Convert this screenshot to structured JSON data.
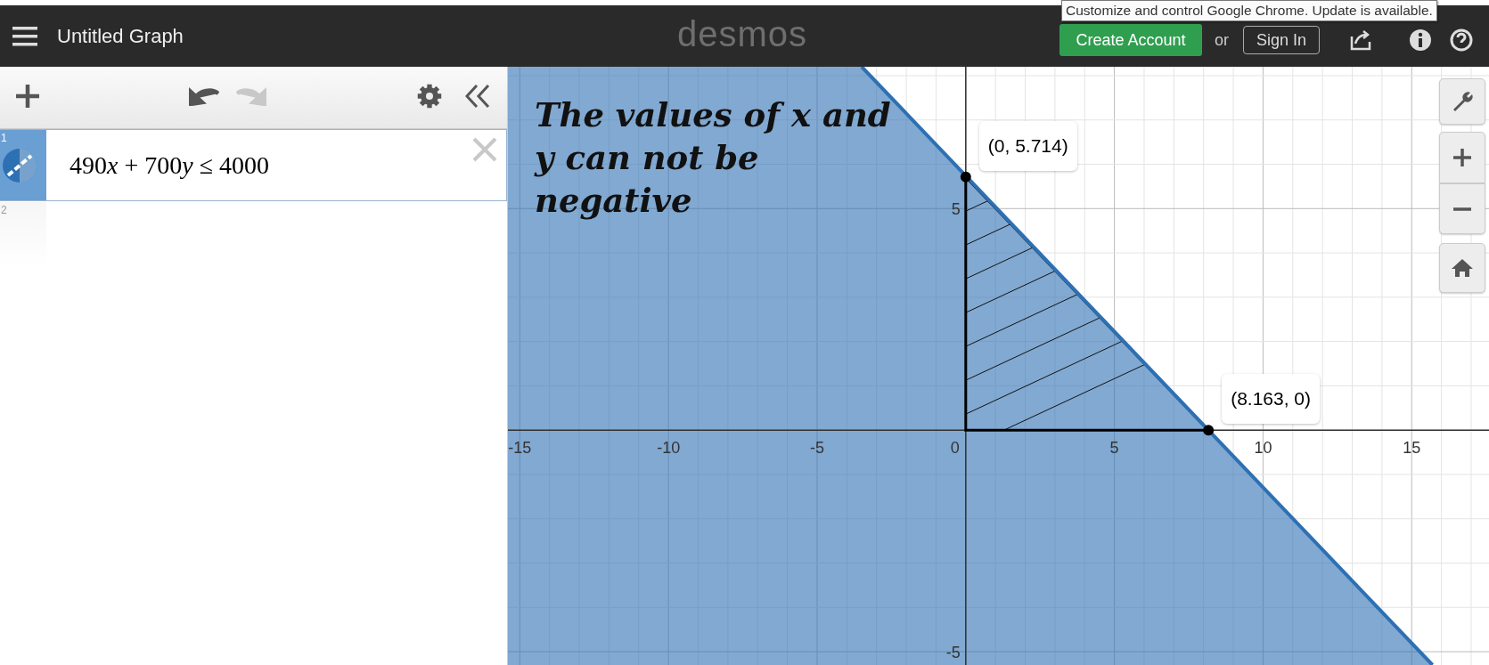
{
  "top_bar": {
    "title": "Untitled Graph",
    "logo": "desmos",
    "create_account": "Create Account",
    "or": "or",
    "sign_in": "Sign In"
  },
  "tooltip": "Customize and control Google Chrome. Update is available.",
  "expressions": [
    {
      "number": "1",
      "parts": [
        {
          "kind": "num",
          "text": "490"
        },
        {
          "kind": "var",
          "text": "x"
        },
        {
          "kind": "num",
          "text": " + 700"
        },
        {
          "kind": "var",
          "text": "y"
        },
        {
          "kind": "num",
          "text": " ≤ 4000"
        }
      ],
      "color": "#2d70b3",
      "selected": true
    },
    {
      "number": "2",
      "selected": false
    }
  ],
  "graph": {
    "note": "The values of x and y can not be negative",
    "origin_label": "0",
    "chart_data": {
      "type": "line",
      "grid": true,
      "x": [
        -3.5,
        15.7
      ],
      "xlim": [
        -15.4,
        17.6
      ],
      "ylim": [
        -5.3,
        8.2
      ],
      "xticks": [
        -15,
        -10,
        -5,
        5,
        10,
        15
      ],
      "yticks": [
        -5,
        5
      ],
      "series": [
        {
          "color": "#2d70b3",
          "values": [
            8.2,
            -5.3
          ]
        }
      ],
      "annotations": [
        {
          "x": 0,
          "y": 5.714,
          "text": "(0, 5.714)"
        },
        {
          "x": 8.163,
          "y": 0,
          "text": "(8.163, 0)"
        }
      ]
    }
  }
}
